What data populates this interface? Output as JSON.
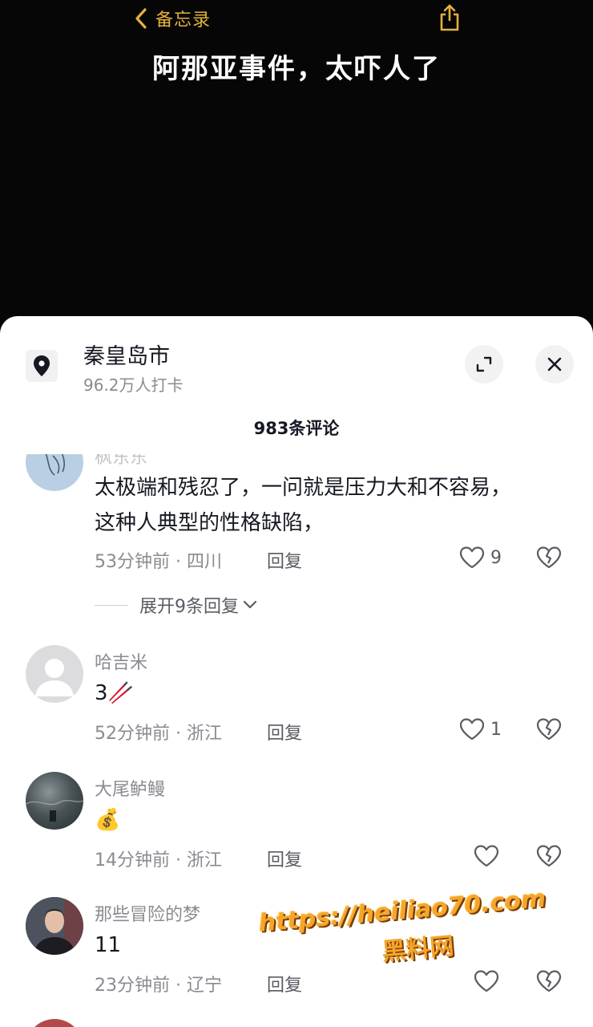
{
  "header": {
    "back_label": "备忘录",
    "title": "阿那亚事件，太吓人了"
  },
  "sheet": {
    "location_name": "秦皇岛市",
    "location_checkins": "96.2万人打卡",
    "comment_count": "983条评论"
  },
  "comments": [
    {
      "user": "枫东东",
      "lines": [
        "太极端和残忍了，一问就是压力大和不容易，",
        "这种人典型的性格缺陷，"
      ],
      "time_location": "53分钟前 · 四川",
      "reply_label": "回复",
      "likes": "9",
      "expand_label": "展开9条回复"
    },
    {
      "user": "哈吉米",
      "lines": [
        "3🥢"
      ],
      "time_location": "52分钟前 · 浙江",
      "reply_label": "回复",
      "likes": "1"
    },
    {
      "user": "大尾鲈鳗",
      "lines": [
        "💰"
      ],
      "time_location": "14分钟前 · 浙江",
      "reply_label": "回复",
      "likes": ""
    },
    {
      "user": "那些冒险的梦",
      "lines": [
        "11"
      ],
      "time_location": "23分钟前 · 辽宁",
      "reply_label": "回复",
      "likes": ""
    }
  ],
  "watermark": {
    "url": "https://heiliao70.com",
    "site_name": "黑料网"
  },
  "colors": {
    "accent_back": "#e3b23c",
    "text_primary": "#161823",
    "text_secondary": "#8a8b91",
    "watermark": "#f6a52b"
  },
  "icons": [
    "chevron-left-icon",
    "share-icon",
    "location-pin-icon",
    "expand-icon",
    "close-icon",
    "heart-icon",
    "broken-heart-icon",
    "chevron-down-icon"
  ]
}
